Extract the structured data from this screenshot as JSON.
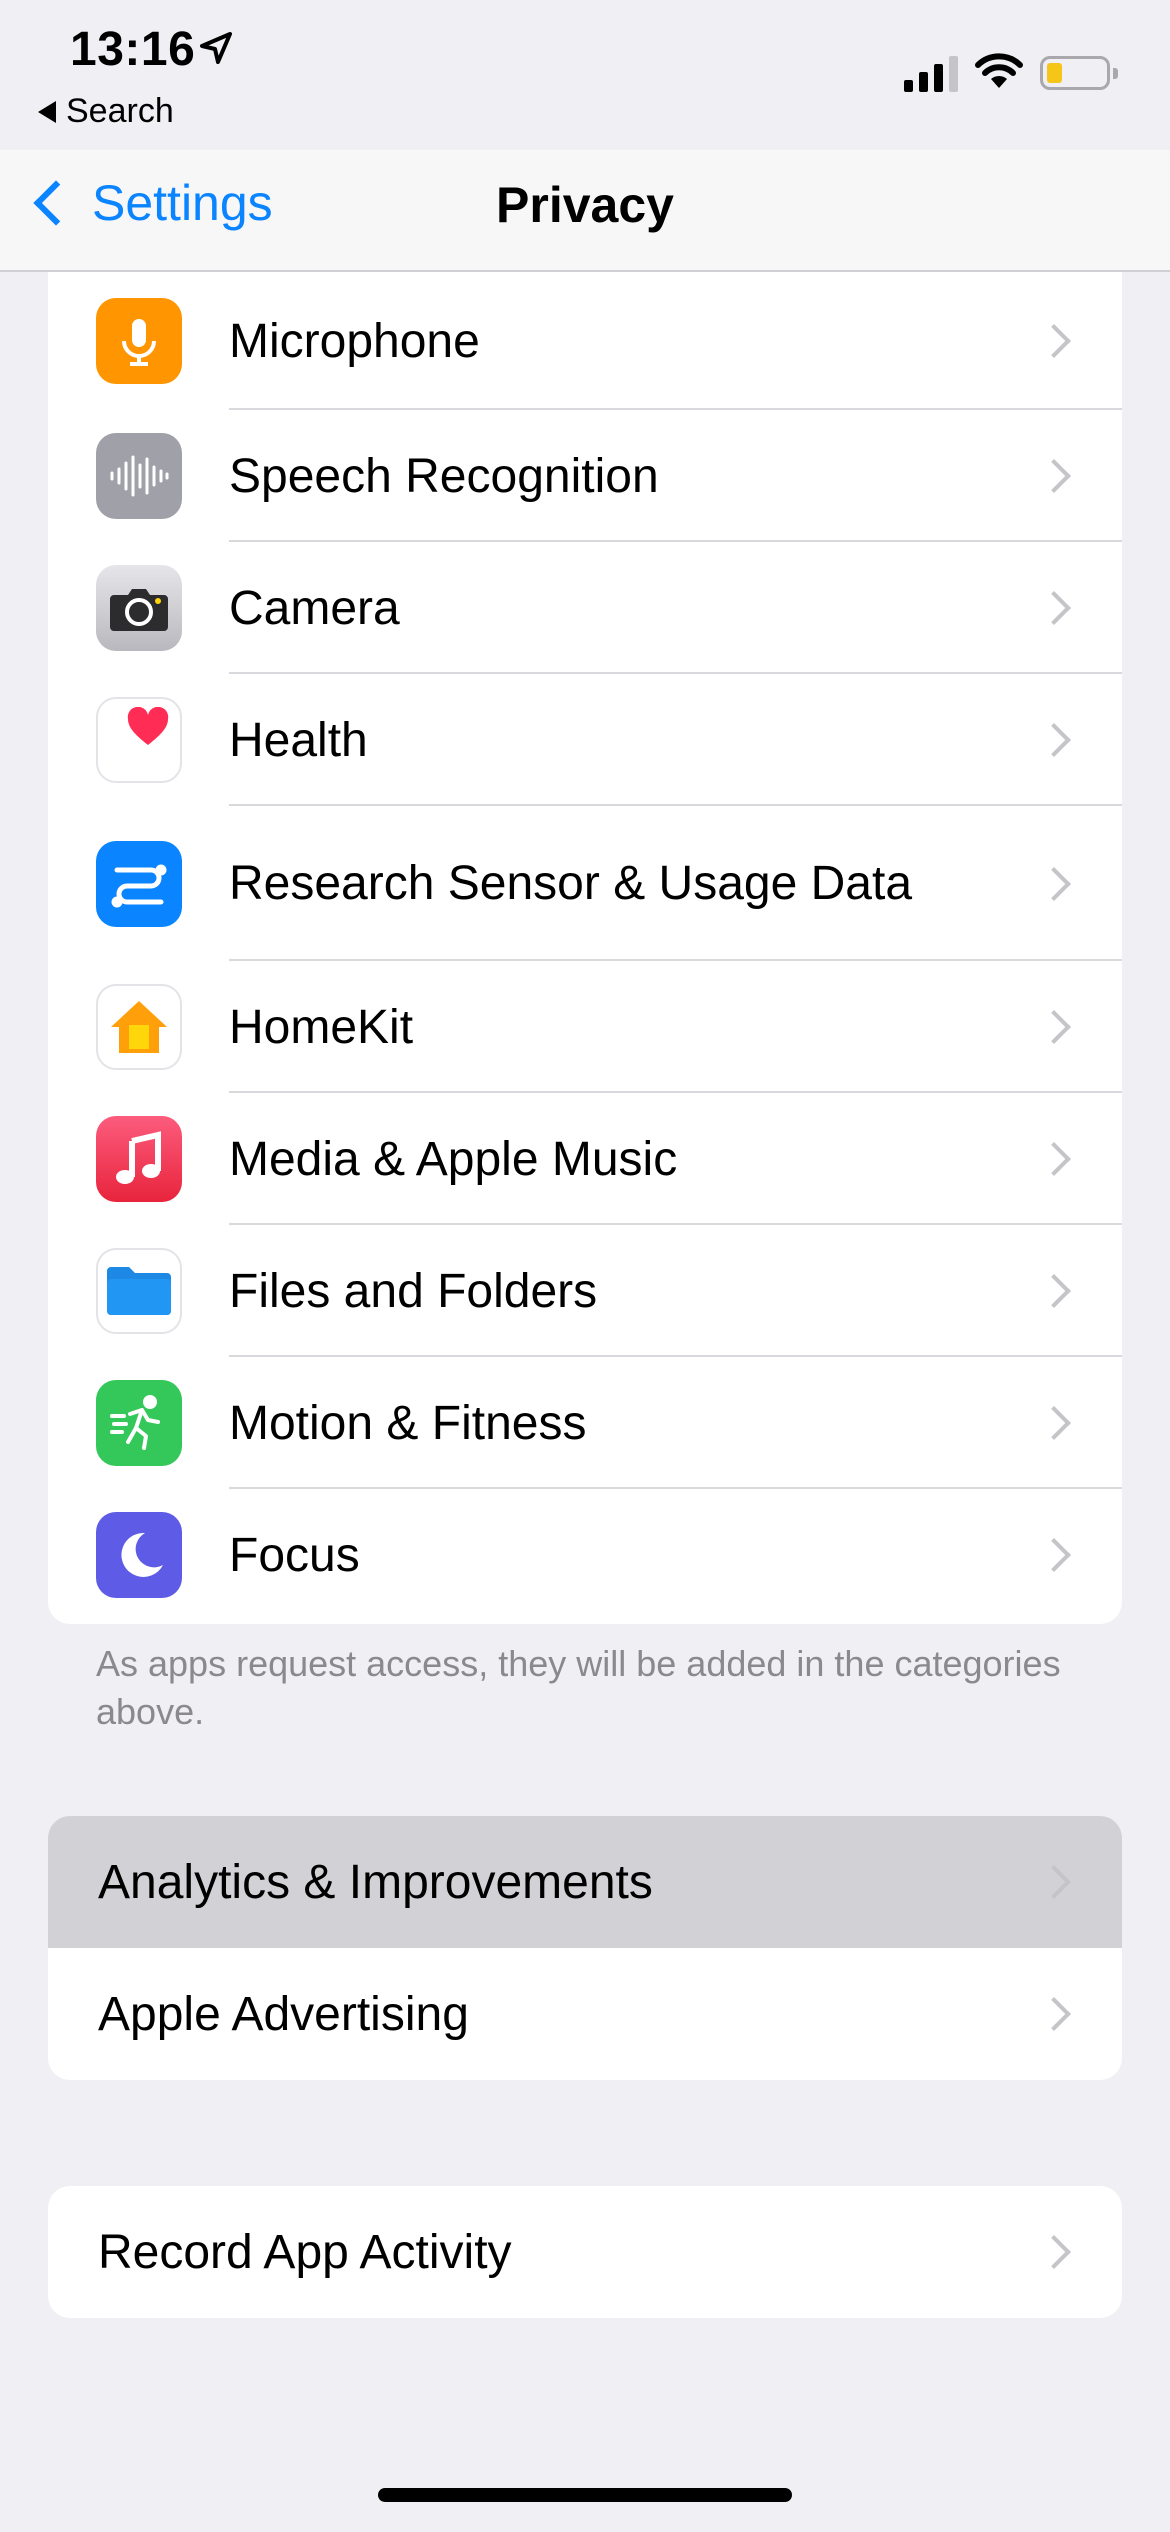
{
  "status_bar": {
    "time": "13:16",
    "back_app": "Search"
  },
  "nav": {
    "back_label": "Settings",
    "title": "Privacy"
  },
  "colors": {
    "accent": "#0a84ff",
    "background": "#efeff4",
    "highlight": "#d1d1d6"
  },
  "permissions": [
    {
      "label": "Microphone",
      "icon": "microphone-icon"
    },
    {
      "label": "Speech Recognition",
      "icon": "waveform-icon"
    },
    {
      "label": "Camera",
      "icon": "camera-icon"
    },
    {
      "label": "Health",
      "icon": "heart-icon"
    },
    {
      "label": "Research Sensor & Usage Data",
      "icon": "research-icon"
    },
    {
      "label": "HomeKit",
      "icon": "home-icon"
    },
    {
      "label": "Media & Apple Music",
      "icon": "music-note-icon"
    },
    {
      "label": "Files and Folders",
      "icon": "folder-icon"
    },
    {
      "label": "Motion & Fitness",
      "icon": "running-figure-icon"
    },
    {
      "label": "Focus",
      "icon": "moon-icon"
    }
  ],
  "footnote": "As apps request access, they will be added in the categories above.",
  "analytics_group": [
    {
      "label": "Analytics & Improvements"
    },
    {
      "label": "Apple Advertising"
    }
  ],
  "activity_group": [
    {
      "label": "Record App Activity"
    }
  ]
}
